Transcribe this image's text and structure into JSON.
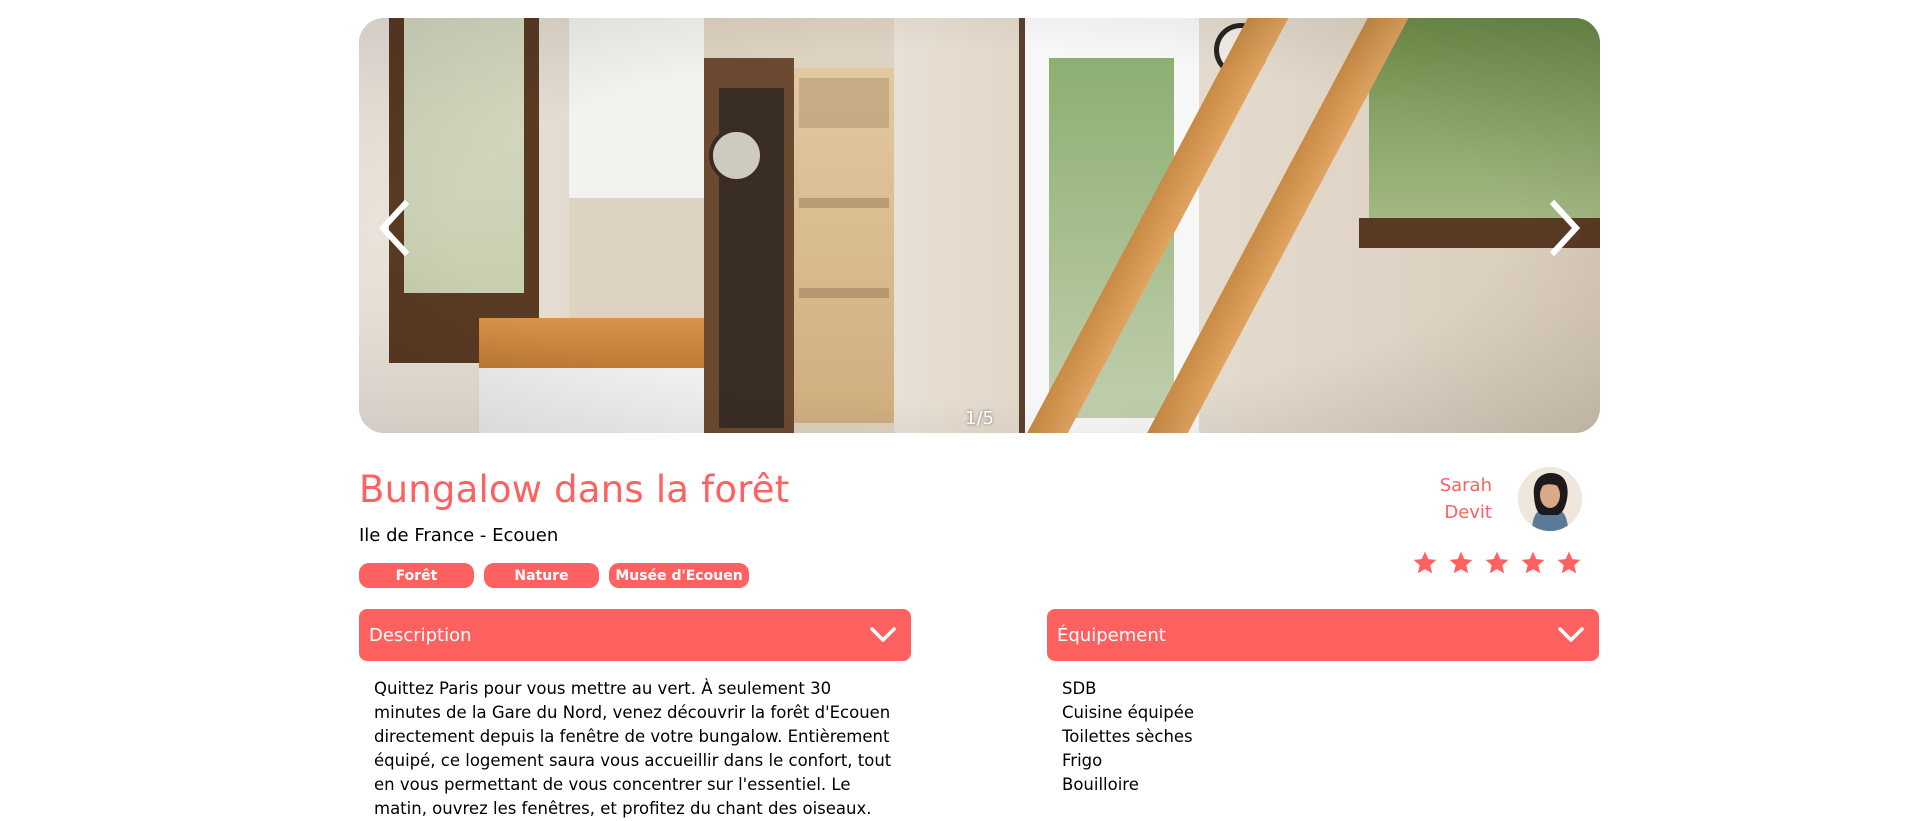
{
  "gallery": {
    "counter": "1/5",
    "prev_icon": "chevron-left-icon",
    "next_icon": "chevron-right-icon"
  },
  "listing": {
    "title": "Bungalow dans la forêt",
    "location": "Ile de France - Ecouen",
    "tags": [
      "Forêt",
      "Nature",
      "Musée d'Ecouen"
    ]
  },
  "host": {
    "first_name": "Sarah",
    "last_name": "Devit"
  },
  "rating": {
    "value": 5,
    "max": 5
  },
  "description": {
    "label": "Description",
    "text": "Quittez Paris pour vous mettre au vert. À seulement 30 minutes de la Gare du Nord, venez découvrir la forêt d'Ecouen directement depuis la fenêtre de votre bungalow. Entièrement équipé, ce logement saura vous accueillir dans le confort, tout en vous permettant de vous concentrer sur l'essentiel. Le matin, ouvrez les fenêtres, et profitez du chant des oiseaux."
  },
  "equipment": {
    "label": "Équipement",
    "items": [
      "SDB",
      "Cuisine équipée",
      "Toilettes sèches",
      "Frigo",
      "Bouilloire"
    ]
  },
  "colors": {
    "accent": "#ff6060",
    "text": "#000000",
    "background": "#ffffff"
  }
}
